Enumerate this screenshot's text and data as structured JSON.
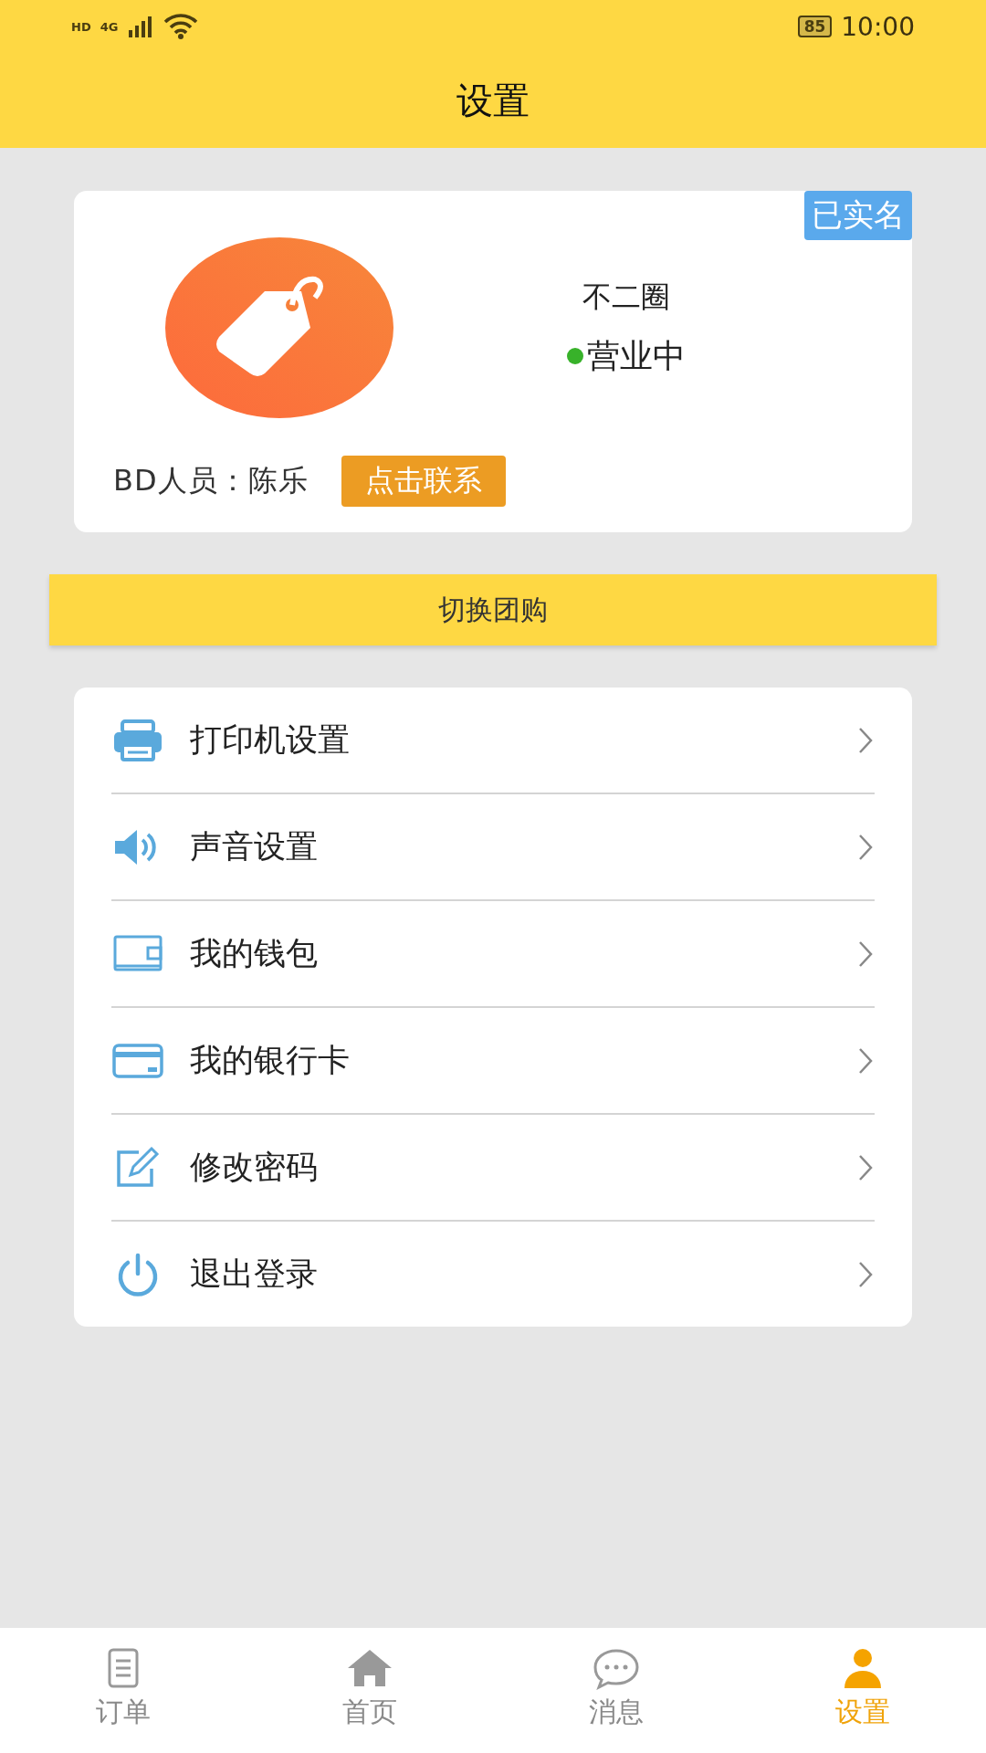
{
  "status_bar": {
    "hd": "HD",
    "network": "4G",
    "battery": "85",
    "time": "10:00"
  },
  "header": {
    "title": "设置"
  },
  "profile": {
    "badge": "已实名",
    "name": "不二圈",
    "status": "营业中",
    "open": true,
    "bd_label": "BD人员：",
    "bd_name": "陈乐",
    "contact_button": "点击联系"
  },
  "switch_button": "切换团购",
  "menu": [
    {
      "kind": "printer",
      "label": "打印机设置"
    },
    {
      "kind": "sound",
      "label": "声音设置"
    },
    {
      "kind": "wallet",
      "label": "我的钱包"
    },
    {
      "kind": "card",
      "label": "我的银行卡"
    },
    {
      "kind": "edit",
      "label": "修改密码"
    },
    {
      "kind": "power",
      "label": "退出登录"
    }
  ],
  "tabs": [
    {
      "kind": "orders",
      "label": "订单",
      "selected": false
    },
    {
      "kind": "home",
      "label": "首页",
      "selected": false
    },
    {
      "kind": "messages",
      "label": "消息",
      "selected": false
    },
    {
      "kind": "settings",
      "label": "设置",
      "selected": true
    }
  ]
}
